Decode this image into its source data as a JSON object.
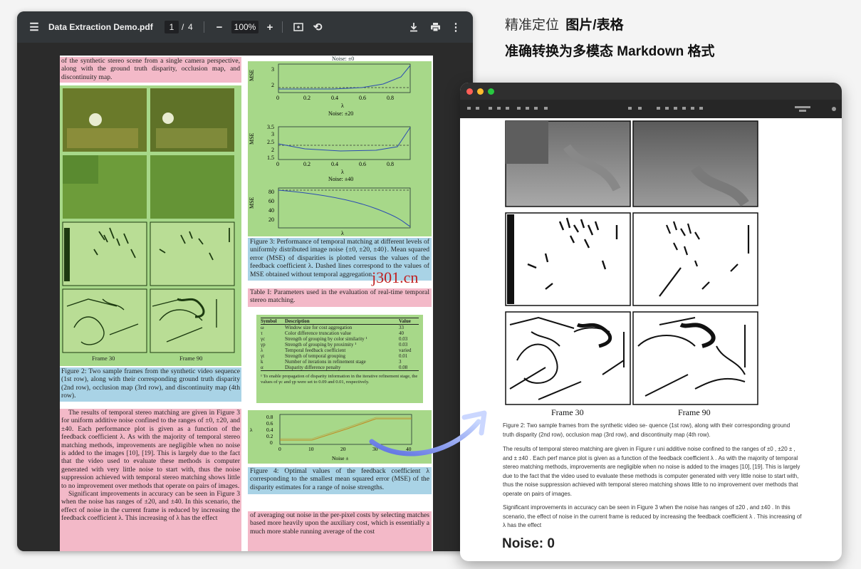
{
  "headline": {
    "line1_prefix": "精准定位",
    "line1_bold": "图片/表格",
    "line2": "准确转换为多模态 Markdown 格式"
  },
  "viewer": {
    "file_name": "Data Extraction Demo.pdf",
    "page_current": "1",
    "page_sep": "/",
    "page_total": "4",
    "zoom": "100%",
    "icons": [
      "menu-icon",
      "zoom-out-icon",
      "zoom-in-icon",
      "fit-page-icon",
      "rotate-icon",
      "download-icon",
      "print-icon",
      "more-icon"
    ]
  },
  "pdf": {
    "top_left_text": "of the synthetic stereo scene from a single camera perspective, along with the ground truth disparity, occlusion map, and discontinuity map.",
    "frame_left": "Frame 30",
    "frame_right": "Frame 90",
    "fig2_caption": "Figure 2: Two sample frames from the synthetic video sequence (1st row), along with their corresponding ground truth disparity (2nd row), occlusion map (3rd row), and discontinuity map (4th row).",
    "body_p1": "The results of temporal stereo matching are given in Figure 3 for uniform additive noise confined to the ranges of ±0, ±20, and ±40. Each performance plot is given as a function of the feedback coefficient λ. As with the majority of temporal stereo matching methods, improvements are negligible when no noise is added to the images [10], [19]. This is largely due to the fact that the video used to evaluate these methods is computer generated with very little noise to start with, thus the noise suppression achieved with temporal stereo matching shows little to no improvement over methods that operate on pairs of images.",
    "body_p2": "Significant improvements in accuracy can be seen in Figure 3 when the noise has ranges of ±20, and ±40. In this scenario, the effect of noise in the current frame is reduced by increasing the feedback coefficient λ. This increasing of λ has the effect",
    "right_bottom_text": "of averaging out noise in the per-pixel costs by selecting matches based more heavily upon the auxiliary cost, which is essentially a much more stable running average of the cost",
    "noise_titles": [
      "Noise: ±0",
      "Noise: ±20",
      "Noise: ±40"
    ],
    "mse_label": "MSE",
    "lambda_label": "λ",
    "x_ticks": [
      "0",
      "0.2",
      "0.4",
      "0.6",
      "0.8"
    ],
    "plot1_yticks": [
      "3",
      "2"
    ],
    "plot2_yticks": [
      "3.5",
      "3",
      "2.5",
      "2",
      "1.5"
    ],
    "plot3_yticks": [
      "80",
      "60",
      "40",
      "20"
    ],
    "fig3_caption": "Figure 3: Performance of temporal matching at different levels of uniformly distributed image noise {±0, ±20, ±40}. Mean squared error (MSE) of disparities is plotted versus the values of the feedback coefficient λ. Dashed lines correspond to the values of MSE obtained without temporal aggregation.",
    "table_caption": "Table I: Parameters used in the evaluation of real-time temporal stereo matching.",
    "table_headers": [
      "Symbol",
      "Description",
      "Value"
    ],
    "table_rows": [
      [
        "ω",
        "Window size for cost aggregation",
        "33"
      ],
      [
        "τ",
        "Color difference truncation value",
        "40"
      ],
      [
        "γc",
        "Strength of grouping by color similarity ¹",
        "0.03"
      ],
      [
        "γp",
        "Strength of grouping by proximity ¹",
        "0.03"
      ],
      [
        "λ",
        "Temporal feedback coefficient",
        "varied"
      ],
      [
        "γt",
        "Strength of temporal grouping",
        "0.01"
      ],
      [
        "k",
        "Number of iterations in refinement stage",
        "3"
      ],
      [
        "α",
        "Disparity difference penalty",
        "0.08"
      ]
    ],
    "table_footnote": "¹ To enable propagation of disparity information in the iterative refinement stage, the values of γc and γp were set to 0.09 and 0.01, respectively.",
    "fig4_ylabel": "λ",
    "fig4_xlabel": "Noise ±",
    "fig4_xticks": [
      "0",
      "10",
      "20",
      "30",
      "40"
    ],
    "fig4_yticks": [
      "0.8",
      "0.6",
      "0.4",
      "0.2",
      "0"
    ],
    "fig4_caption": "Figure 4: Optimal values of the feedback coefficient λ corresponding to the smallest mean squared error (MSE) of the disparity estimates for a range of noise strengths.",
    "watermark": "j301.cn"
  },
  "markdown": {
    "frame_left": "Frame 30",
    "frame_right": "Frame 90",
    "caption": "Figure 2: Two sample frames from the synthetic video se- quence (1st row), along with their corresponding ground truth disparity (2nd row), occlusion map (3rd row), and discontinuity map (4th row).",
    "p1": "The results of temporal stereo matching are given in Figure r uni additive noise confined to the ranges of ±0 , ±20 ± , and ± ±40 . Each perf mance plot is given as a function of the feedback coefficient λ . As with the majority of temporal stereo matching methods, improvements are negligible when no noise is added to the images [10], [19]. This is largely due to the fact that the video used to evaluate these methods is computer generated with very little noise to start with, thus the noise suppression achieved with temporal stereo matching shows little to no improvement over methods that operate on pairs of images.",
    "p2": "Significant improvements in accuracy can be seen in Figure 3 when the noise has ranges of ±20 , and ±40 . In this scenario, the effect of noise in the current frame is reduced by increasing the feedback coefficient λ . This increasing of λ has the effect",
    "heading": "Noise: 0"
  },
  "colors": {
    "pink": "#f3b9c8",
    "green": "#a7d889",
    "blue": "#a9d3e6",
    "arrow_start": "#5a6ee0",
    "arrow_end": "#c9d8ff"
  }
}
